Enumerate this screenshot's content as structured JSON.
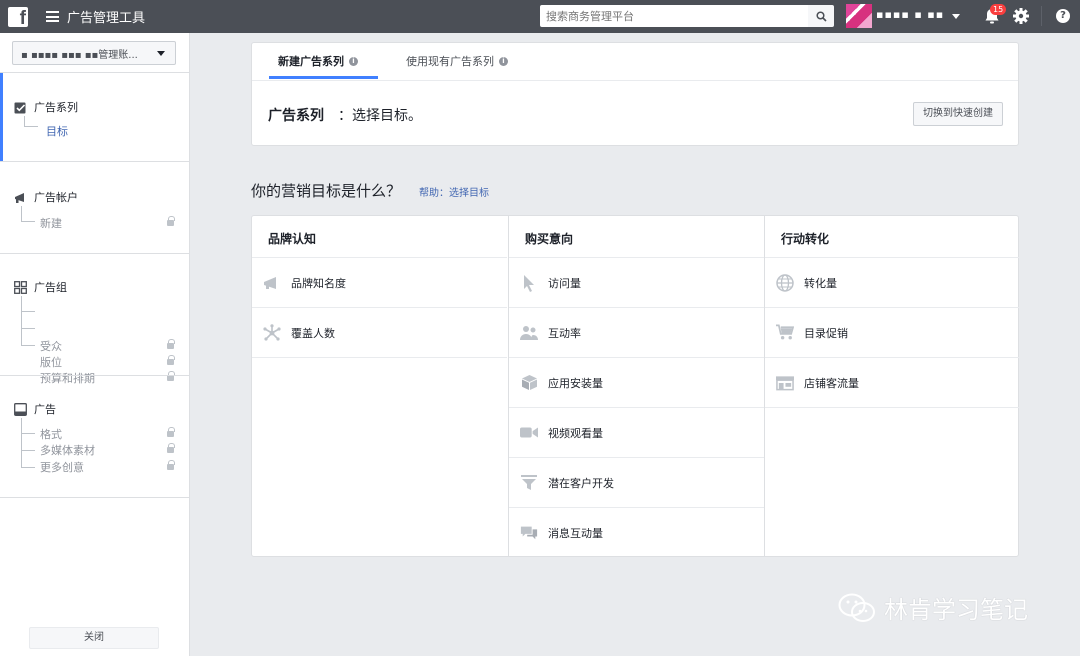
{
  "topbar": {
    "logo": "f",
    "title": "广告管理工具",
    "search_placeholder": "搜索商务管理平台",
    "account_name": "▪▪▪▪ ▪ ▪▪",
    "notification_count": "15",
    "help": "?"
  },
  "sidebar": {
    "account_select": "▪ ▪▪▪▪ ▪▪▪ ▪▪管理账...",
    "sections": [
      {
        "title": "广告系列",
        "items": [
          {
            "label": "目标"
          }
        ]
      },
      {
        "title": "广告帐户",
        "items": [
          {
            "label": "新建"
          }
        ]
      },
      {
        "title": "广告组",
        "items": [
          {
            "label": "受众"
          },
          {
            "label": "版位"
          },
          {
            "label": "预算和排期"
          }
        ]
      },
      {
        "title": "广告",
        "items": [
          {
            "label": "格式"
          },
          {
            "label": "多媒体素材"
          },
          {
            "label": "更多创意"
          }
        ]
      }
    ],
    "close_label": "关闭"
  },
  "tabs": [
    {
      "label": "新建广告系列"
    },
    {
      "label": "使用现有广告系列"
    }
  ],
  "campaign": {
    "label": "广告系列",
    "text": "：选择目标。",
    "switch_label": "切换到快速创建"
  },
  "objective": {
    "question": "你的营销目标是什么？",
    "help": "帮助：选择目标"
  },
  "columns": [
    {
      "header": "品牌认知",
      "items": [
        {
          "label": "品牌知名度",
          "icon": "megaphone-icon"
        },
        {
          "label": "覆盖人数",
          "icon": "reach-icon"
        }
      ]
    },
    {
      "header": "购买意向",
      "items": [
        {
          "label": "访问量",
          "icon": "cursor-icon"
        },
        {
          "label": "互动率",
          "icon": "people-icon"
        },
        {
          "label": "应用安装量",
          "icon": "box-icon"
        },
        {
          "label": "视频观看量",
          "icon": "video-icon"
        },
        {
          "label": "潜在客户开发",
          "icon": "funnel-icon"
        },
        {
          "label": "消息互动量",
          "icon": "chat-icon"
        }
      ]
    },
    {
      "header": "行动转化",
      "items": [
        {
          "label": "转化量",
          "icon": "globe-icon"
        },
        {
          "label": "目录促销",
          "icon": "cart-icon"
        },
        {
          "label": "店铺客流量",
          "icon": "store-icon"
        }
      ]
    }
  ],
  "watermark": "林肯学习笔记",
  "colors": {
    "topbar": "#4b4f56",
    "accent": "#4080ff",
    "link": "#4267b2",
    "icon": "#bec3c9"
  }
}
